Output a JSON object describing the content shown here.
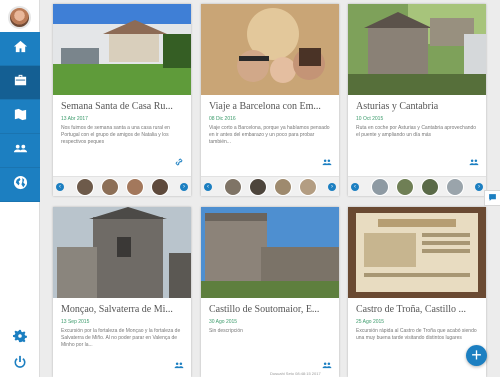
{
  "colors": {
    "accent": "#1c7fc1",
    "date_green": "#3a9a6a",
    "background": "#ececec"
  },
  "sidebar": {
    "avatar_icon": "user-avatar",
    "items": [
      {
        "name": "home",
        "icon": "home-icon"
      },
      {
        "name": "trips",
        "icon": "briefcase-icon"
      },
      {
        "name": "maps",
        "icon": "map-pin-icon"
      },
      {
        "name": "friends",
        "icon": "people-icon"
      },
      {
        "name": "explore",
        "icon": "globe-icon"
      }
    ],
    "bottom": [
      {
        "icon": "gear-icon"
      },
      {
        "icon": "power-icon"
      }
    ]
  },
  "cards": [
    {
      "title": "Semana Santa de Casa Ru...",
      "date": "13 Abr 2017",
      "description": "Nos fuimos de semana santa a una casa rural en Portugal con el grupo de amigos de Natalia y los respectivos peques",
      "action_icon": "link-icon"
    },
    {
      "title": "Viaje a Barcelona con Em...",
      "date": "08 Dic 2016",
      "description": "Viaje corto a Barcelona, porque ya habíamos pensado en ir antes del embarazo y un poco para probar también...",
      "action_icon": "people-icon"
    },
    {
      "title": "Asturias y Cantabria",
      "date": "10 Oct 2015",
      "description": "Ruta en coche por Asturias y Cantabria aprovechando el puente y ampliando un día más",
      "action_icon": "people-icon"
    },
    {
      "title": "Monçao, Salvaterra de Mi...",
      "date": "13 Sep 2015",
      "description": "Excursión por la fortaleza de Monçao y la fortaleza de Salvaterra de Miño. Al no poder parar en Valença de Minho por la...",
      "action_icon": "people-icon"
    },
    {
      "title": "Castillo de Soutomaior, E...",
      "date": "30 Ago 2015",
      "description": "Sin descripción",
      "action_icon": "people-icon"
    },
    {
      "title": "Castro de Troña, Castillo ...",
      "date": "25 Ago 2015",
      "description": "Excursión rápida al Castro de Troña que acabó siendo una muy buena tarde visitando distintos lugares",
      "action_icon": "people-icon"
    }
  ],
  "fab": {
    "label": "+"
  },
  "chat_icon": "chat-icon",
  "footer": {
    "text": "Dusuahi Seto 08:48:15 2017"
  }
}
